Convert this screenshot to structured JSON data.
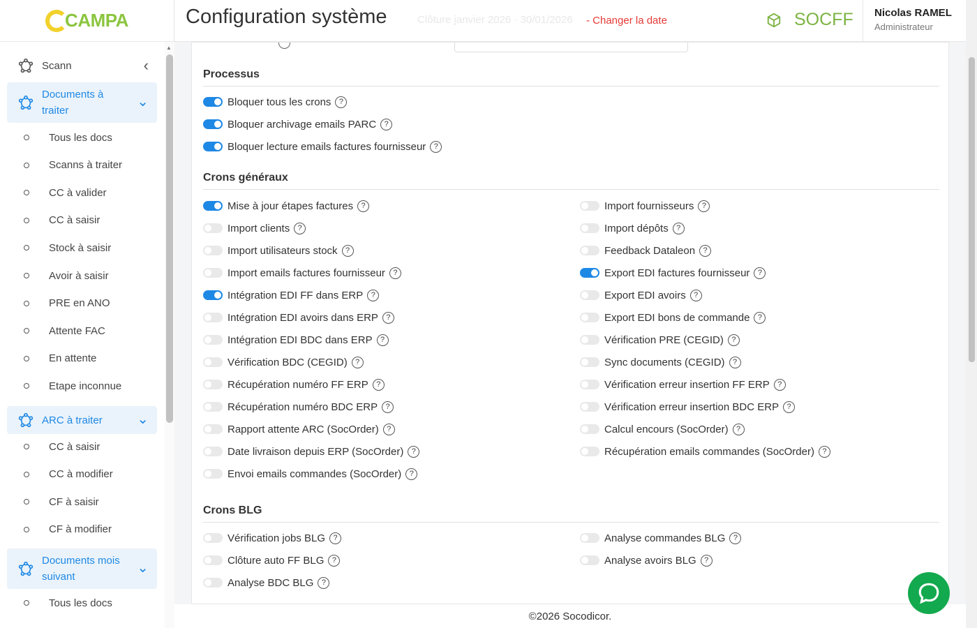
{
  "app": {
    "logo_text": "CAMPA"
  },
  "header": {
    "title": "Configuration système",
    "faded_text": "Clôture janvier 2026 · 30/01/2026",
    "change_date": "- Changer la date",
    "company": "SOCFF",
    "user_name": "Nicolas RAMEL",
    "user_role": "Administrateur"
  },
  "sidebar": {
    "scann": "Scann",
    "groups": [
      {
        "label": "Documents à traiter",
        "items": [
          "Tous les docs",
          "Scanns à traiter",
          "CC à valider",
          "CC à saisir",
          "Stock à saisir",
          "Avoir à saisir",
          "PRE en ANO",
          "Attente FAC",
          "En attente",
          "Etape inconnue"
        ]
      },
      {
        "label": "ARC à traiter",
        "items": [
          "CC à saisir",
          "CC à modifier",
          "CF à saisir",
          "CF à modifier"
        ]
      },
      {
        "label": "Documents mois suivant",
        "items": [
          "Tous les docs"
        ]
      }
    ]
  },
  "sections": {
    "processus": {
      "title": "Processus",
      "items": [
        {
          "label": "Bloquer tous les crons",
          "on": true
        },
        {
          "label": "Bloquer archivage emails PARC",
          "on": true
        },
        {
          "label": "Bloquer lecture emails factures fournisseur",
          "on": true
        }
      ]
    },
    "crons_generaux": {
      "title": "Crons généraux",
      "left": [
        {
          "label": "Mise à jour étapes factures",
          "on": true
        },
        {
          "label": "Import clients",
          "on": false
        },
        {
          "label": "Import utilisateurs stock",
          "on": false
        },
        {
          "label": "Import emails factures fournisseur",
          "on": false
        },
        {
          "label": "Intégration EDI FF dans ERP",
          "on": true
        },
        {
          "label": "Intégration EDI avoirs dans ERP",
          "on": false
        },
        {
          "label": "Intégration EDI BDC dans ERP",
          "on": false
        },
        {
          "label": "Vérification BDC (CEGID)",
          "on": false
        },
        {
          "label": "Récupération numéro FF ERP",
          "on": false
        },
        {
          "label": "Récupération numéro BDC ERP",
          "on": false
        },
        {
          "label": "Rapport attente ARC (SocOrder)",
          "on": false
        },
        {
          "label": "Date livraison depuis ERP (SocOrder)",
          "on": false
        },
        {
          "label": "Envoi emails commandes (SocOrder)",
          "on": false
        }
      ],
      "right": [
        {
          "label": "Import fournisseurs",
          "on": false
        },
        {
          "label": "Import dépôts",
          "on": false
        },
        {
          "label": "Feedback Dataleon",
          "on": false
        },
        {
          "label": "Export EDI factures fournisseur",
          "on": true
        },
        {
          "label": "Export EDI avoirs",
          "on": false
        },
        {
          "label": "Export EDI bons de commande",
          "on": false
        },
        {
          "label": "Vérification PRE (CEGID)",
          "on": false
        },
        {
          "label": "Sync documents (CEGID)",
          "on": false
        },
        {
          "label": "Vérification erreur insertion FF ERP",
          "on": false
        },
        {
          "label": "Vérification erreur insertion BDC ERP",
          "on": false
        },
        {
          "label": "Calcul encours (SocOrder)",
          "on": false
        },
        {
          "label": "Récupération emails commandes (SocOrder)",
          "on": false
        }
      ]
    },
    "crons_blg": {
      "title": "Crons BLG",
      "left": [
        {
          "label": "Vérification jobs BLG",
          "on": false
        },
        {
          "label": "Clôture auto FF BLG",
          "on": false
        },
        {
          "label": "Analyse BDC BLG",
          "on": false
        }
      ],
      "right": [
        {
          "label": "Analyse commandes BLG",
          "on": false
        },
        {
          "label": "Analyse avoirs BLG",
          "on": false
        }
      ]
    }
  },
  "help_glyph": "?",
  "footer": "©2026 Socodicor.",
  "colors": {
    "accent": "#1e88e5",
    "brand": "#7cb342",
    "danger": "#e53935",
    "chat": "#13a94e"
  }
}
